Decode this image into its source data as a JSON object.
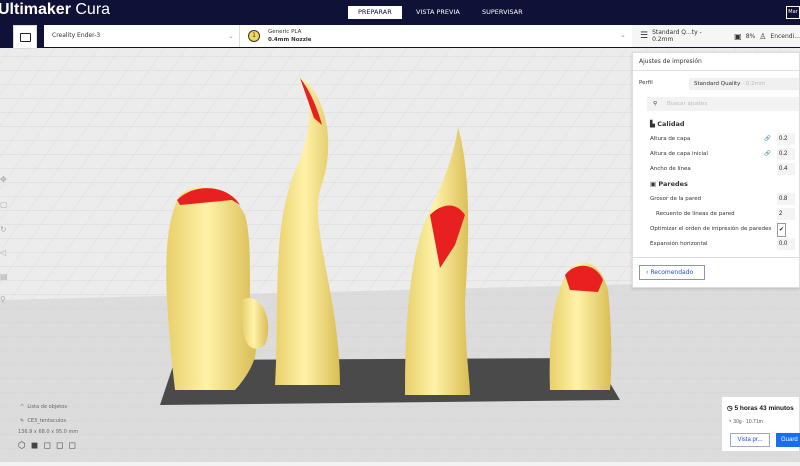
{
  "app": {
    "logo_bold": "Ultimaker",
    "logo_light": " Cura"
  },
  "stages": [
    "PREPARAR",
    "VISTA PREVIA",
    "SUPERVISAR"
  ],
  "account_label": "Mar",
  "printer": {
    "name": "Creality Ender-3"
  },
  "material": {
    "badge": "1",
    "name": "Generic PLA",
    "nozzle": "0.4mm Nozzle"
  },
  "print_settings": {
    "profile": "Standard Q...ty - 0.2mm",
    "infill": "8%",
    "support": "Encendi..."
  },
  "panel": {
    "title": "Ajustes de impresión",
    "profile_label": "Perfil",
    "profile_value": "Standard Quality",
    "profile_suffix": "- 0.2mm",
    "search_placeholder": "Buscar ajustes",
    "sections": [
      {
        "title": "Calidad",
        "rows": [
          {
            "label": "Altura de capa",
            "value": "0.2"
          },
          {
            "label": "Altura de capa inicial",
            "value": "0.2"
          },
          {
            "label": "Ancho de línea",
            "value": "0.4"
          }
        ]
      },
      {
        "title": "Paredes",
        "rows": [
          {
            "label": "Grosor de la pared",
            "value": "0.8"
          },
          {
            "label": "Recuento de líneas de pared",
            "value": "2"
          },
          {
            "label": "Optimizar el orden de impresión de paredes",
            "value": "✔"
          },
          {
            "label": "Expansión horizontal",
            "value": "0.0"
          }
        ]
      }
    ],
    "recommended_label": "Recomendado"
  },
  "objects": {
    "list_label": "Lista de objetos",
    "name": "CE3_tentacuios",
    "dimensions": "136.9 x 68.0 x 95.0 mm"
  },
  "estimate": {
    "time": "5 horas 43 minutos",
    "material": "30g · 10.71m",
    "preview_label": "Vista pr...",
    "save_label": "Guard"
  },
  "colors": {
    "header": "#0f1137",
    "accent": "#196ef0",
    "model": "#f8e58c",
    "overhang": "#e82020"
  }
}
